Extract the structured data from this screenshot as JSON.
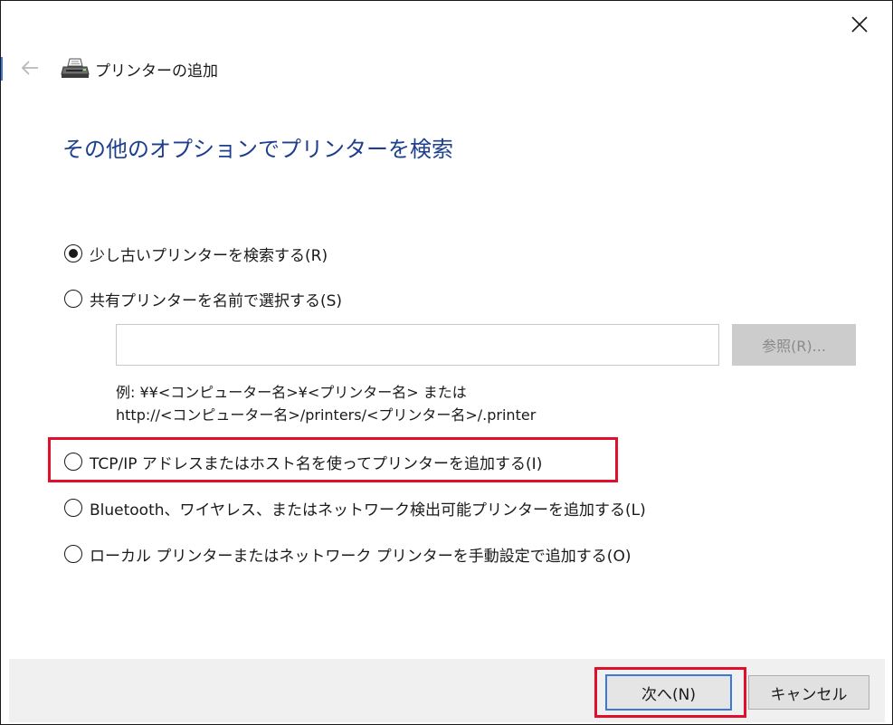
{
  "window": {
    "title": "プリンターの追加",
    "close_icon": "close-icon",
    "back_icon": "back-arrow-icon",
    "printer_icon": "printer-icon"
  },
  "heading": "その他のオプションでプリンターを検索",
  "options": [
    {
      "label": "少し古いプリンターを検索する(R)",
      "checked": true
    },
    {
      "label": "共有プリンターを名前で選択する(S)",
      "checked": false
    },
    {
      "label": "TCP/IP アドレスまたはホスト名を使ってプリンターを追加する(I)",
      "checked": false
    },
    {
      "label": "Bluetooth、ワイヤレス、またはネットワーク検出可能プリンターを追加する(L)",
      "checked": false
    },
    {
      "label": "ローカル プリンターまたはネットワーク プリンターを手動設定で追加する(O)",
      "checked": false
    }
  ],
  "shared_printer": {
    "input_value": "",
    "browse_label": "参照(R)...",
    "example_line1": "例: ¥¥<コンピューター名>¥<プリンター名> または",
    "example_line2": "http://<コンピューター名>/printers/<プリンター名>/.printer"
  },
  "footer": {
    "next_label": "次へ(N)",
    "cancel_label": "キャンセル"
  },
  "colors": {
    "heading": "#1d3f8e",
    "highlight": "#e0102a",
    "focus_border": "#3b78d8"
  }
}
